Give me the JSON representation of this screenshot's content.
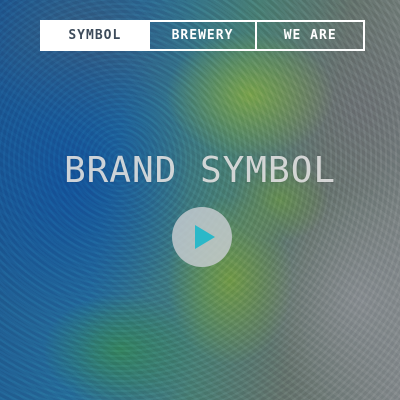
{
  "nav": {
    "tabs": [
      {
        "label": "SYMBOL",
        "active": true
      },
      {
        "label": "BREWERY",
        "active": false
      },
      {
        "label": "WE ARE",
        "active": false
      }
    ]
  },
  "hero": {
    "title": "BRAND SYMBOL",
    "play_icon": "play-icon"
  },
  "colors": {
    "accent": "#2bb8c8",
    "nav_border": "#ffffff",
    "active_tab_text": "#3d4b5a"
  }
}
